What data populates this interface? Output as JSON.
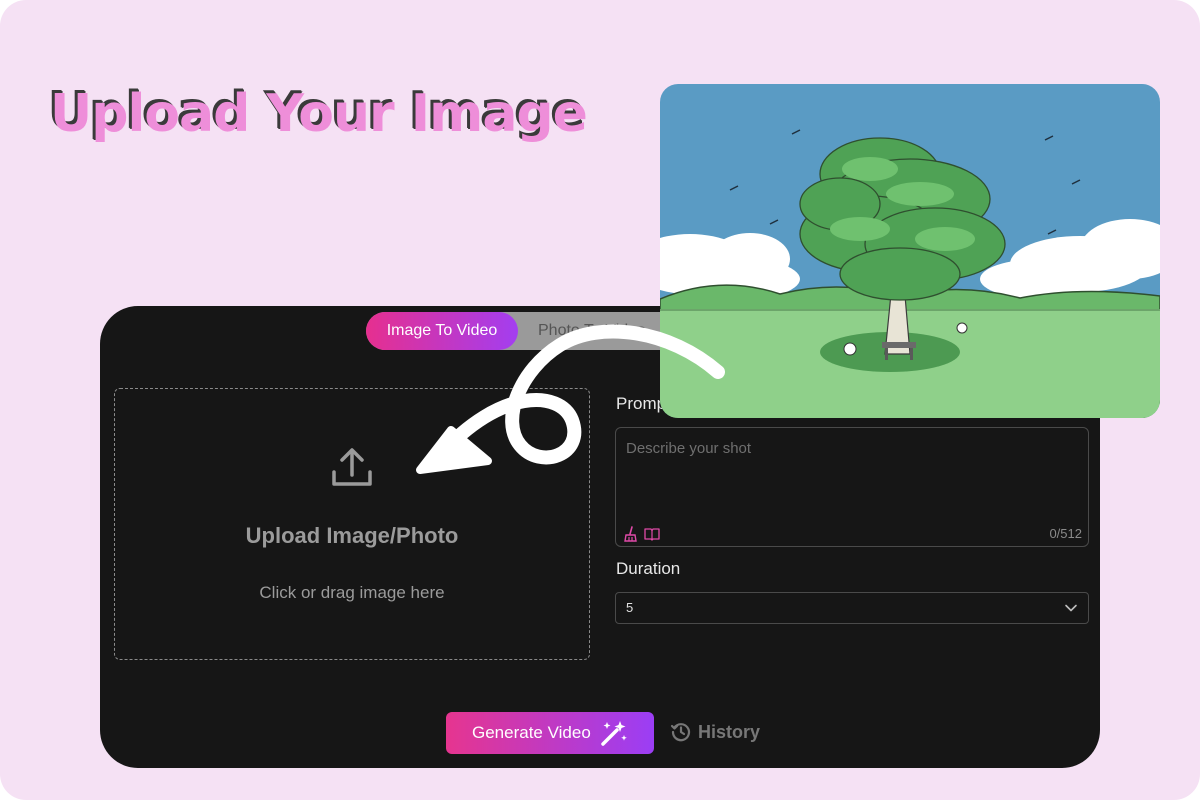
{
  "page": {
    "background": "#f5e1f4"
  },
  "headline": {
    "text": "Upload Your Image",
    "color": "#ee8ed9"
  },
  "tabs": [
    {
      "label": "Image To Video",
      "active": true
    },
    {
      "label": "Photo To Video",
      "active": false
    }
  ],
  "upload": {
    "icon": "upload-icon",
    "title": "Upload Image/Photo",
    "subtitle": "Click or drag image here"
  },
  "prompt": {
    "label": "Prompt",
    "placeholder": "Describe your shot",
    "counter": "0/512",
    "tools": [
      "broom-icon",
      "book-icon"
    ]
  },
  "duration": {
    "label": "Duration",
    "selected": "5"
  },
  "actions": {
    "generate_label": "Generate Video",
    "generate_icon": "magic-wand-icon",
    "history_label": "History",
    "history_icon": "history-icon"
  },
  "colors": {
    "panel": "#161616",
    "accent_start": "#e6358f",
    "accent_end": "#9b3ef5"
  },
  "preview_image": {
    "subject": "illustration of a large tree on a green meadow with clouds and blue sky"
  }
}
